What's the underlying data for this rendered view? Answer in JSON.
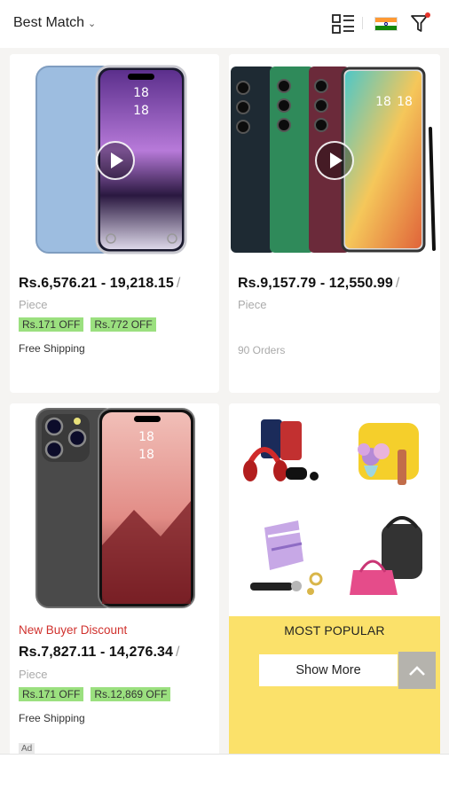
{
  "header": {
    "sort_label": "Best Match",
    "icons": [
      "chevron-down-icon",
      "grid-view-icon",
      "india-flag-icon",
      "filter-icon"
    ]
  },
  "products": [
    {
      "price": "Rs.6,576.21 - 19,218.15",
      "price_sep": "/",
      "unit": "Piece",
      "coupons": [
        "Rs.171 OFF",
        "Rs.772 OFF"
      ],
      "shipping": "Free Shipping"
    },
    {
      "price": "Rs.9,157.79 - 12,550.99",
      "price_sep": "/",
      "unit": "Piece",
      "orders": "90 Orders"
    },
    {
      "badge": "New Buyer Discount",
      "price": "Rs.7,827.11 - 14,276.34",
      "price_sep": "/",
      "unit": "Piece",
      "coupons": [
        "Rs.171 OFF",
        "Rs.12,869 OFF"
      ],
      "shipping": "Free Shipping",
      "ad_tag": "Ad"
    }
  ],
  "popular": {
    "title": "MOST POPULAR",
    "button": "Show More"
  },
  "phone_screen": {
    "time_a": "18",
    "time_b": "18"
  },
  "colors": {
    "coupon_bg": "#9be07f",
    "new_buyer": "#d0312d",
    "popular_bg": "#fbe16a"
  }
}
